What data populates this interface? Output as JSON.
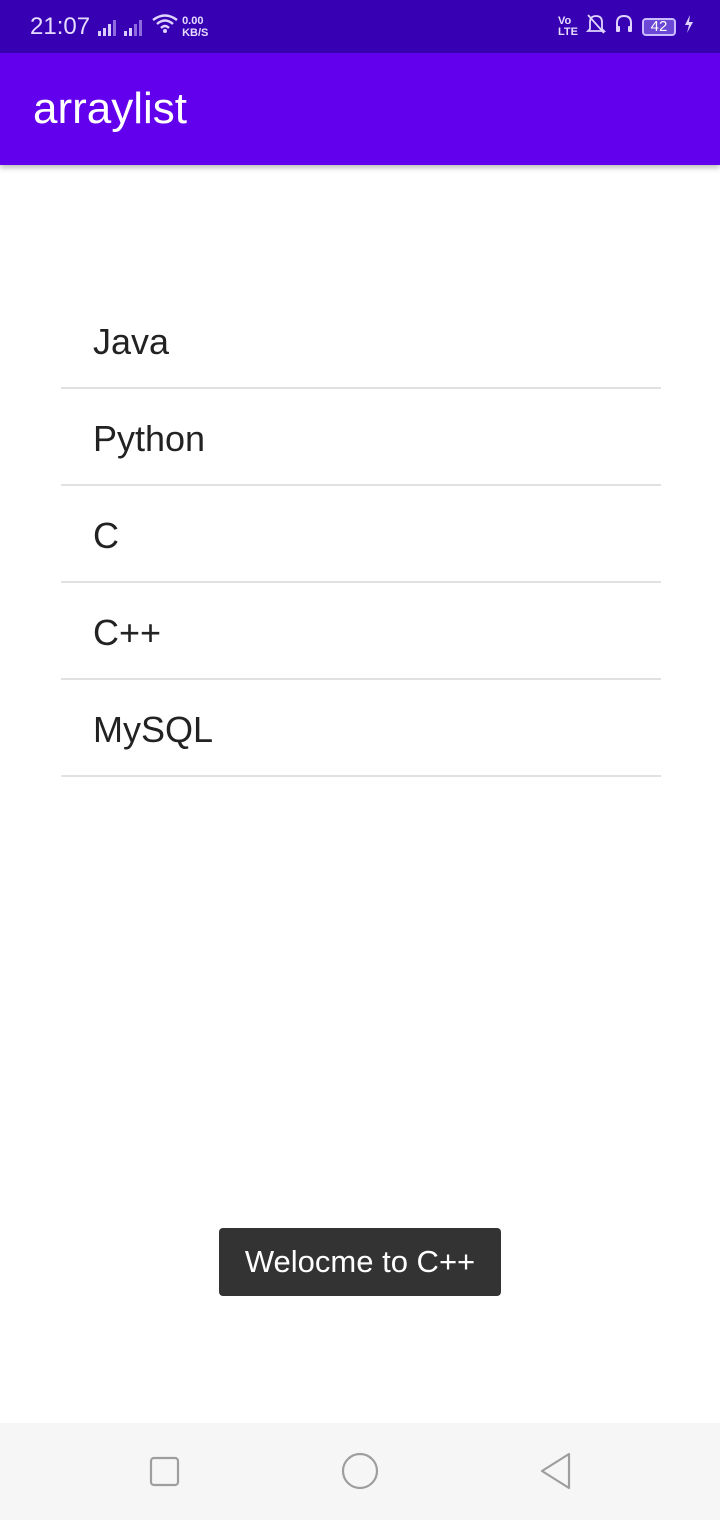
{
  "status_bar": {
    "time": "21:07",
    "net_speed_value": "0.00",
    "net_speed_unit": "KB/S",
    "volte_top": "Vo",
    "volte_bottom": "LTE",
    "battery_level": "42",
    "icons": [
      "signal-icon",
      "signal-icon",
      "wifi-icon",
      "volte-icon",
      "bell-muted-icon",
      "headset-icon",
      "battery-icon",
      "charging-icon"
    ]
  },
  "app_bar": {
    "title": "arraylist",
    "color": "#6200ee",
    "status_color": "#3700b3"
  },
  "list": {
    "items": [
      "Java",
      "Python",
      "C",
      "C++",
      "MySQL"
    ]
  },
  "toast": {
    "message": "Welocme to C++"
  },
  "nav_bar": {
    "buttons": [
      "recents-icon",
      "home-icon",
      "back-icon"
    ]
  }
}
